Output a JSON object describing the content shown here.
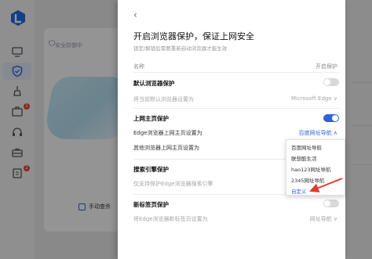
{
  "sidebar": {
    "items": [
      {
        "icon": "monitor-icon"
      },
      {
        "icon": "shield-icon",
        "active": true
      },
      {
        "icon": "broom-icon"
      },
      {
        "icon": "toolbox-icon",
        "badge": "1"
      },
      {
        "icon": "headset-icon"
      },
      {
        "icon": "briefcase-icon"
      },
      {
        "icon": "clipboard-icon",
        "badge": "2"
      }
    ]
  },
  "background": {
    "security_label": "安全防御中",
    "manual_scan_label": "手动查杀"
  },
  "panel": {
    "back": "‹",
    "title": "开启浏览器保护，保证上网安全",
    "subtitle": "锁定/解锁后需要重新启动浏览器才能生效",
    "col_name": "名称",
    "col_state": "开启保护",
    "default_browser": {
      "title": "默认浏览器保护",
      "label": "将当前默认浏览器设置为",
      "value": "Microsoft Edge ∨"
    },
    "homepage": {
      "title": "上网主页保护",
      "edge_label": "Edge浏览器上网主页设置为",
      "edge_value": "百度网址导航 ∧",
      "other_label": "其他浏览器上网主页设置为"
    },
    "search": {
      "title": "搜索引擎保护",
      "label": "仅支持保护Edge浏览器搜索引擎"
    },
    "newtab": {
      "title": "新标签页保护",
      "label": "将Edge浏览器新标签页设置为",
      "value": "网址导航 ∨"
    }
  },
  "dropdown": {
    "options": [
      "百度网址导航",
      "联想酷生活",
      "hao123网址导航",
      "2345网址导航",
      "自定义"
    ],
    "highlighted": "自定义"
  },
  "colors": {
    "accent": "#2b64d6",
    "arrow": "#e23b2e"
  }
}
